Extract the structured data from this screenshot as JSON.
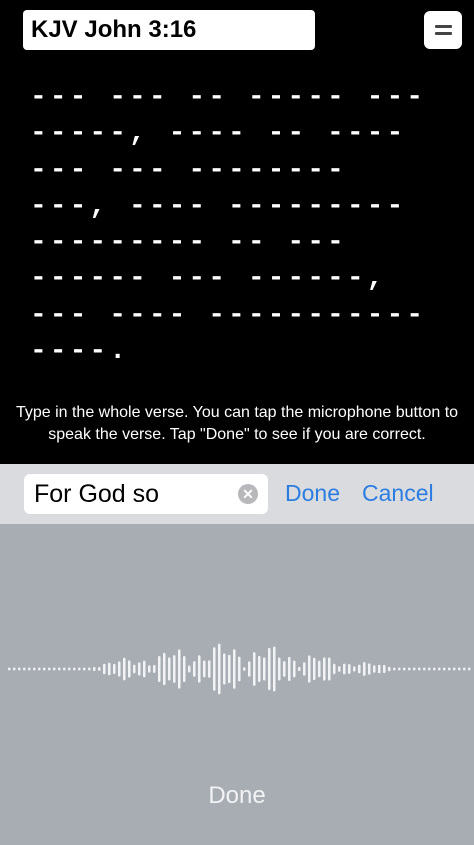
{
  "header": {
    "title": "KJV John 3:16",
    "menu_icon": "hamburger-icon"
  },
  "verse_mask": [
    "--- --- -- ----- ---",
    "-----, ---- -- ----",
    "--- --- --------",
    "---, ---- ---------",
    "--------- -- ---",
    "------ --- ------,",
    "--- ---- -----------",
    "----."
  ],
  "instructions": "Type in the whole verse.  You can tap the microphone button to speak the verse.  Tap \"Done\" to see if you are correct.",
  "input": {
    "value": "For God so",
    "clear_icon": "clear-icon",
    "done_label": "Done",
    "cancel_label": "Cancel"
  },
  "dictation": {
    "done_label": "Done",
    "waveform_icon": "waveform-icon"
  },
  "colors": {
    "background": "#000000",
    "accent": "#2b7de1",
    "input_bar": "#d9dbde",
    "dictation_panel": "#a8adb3"
  }
}
